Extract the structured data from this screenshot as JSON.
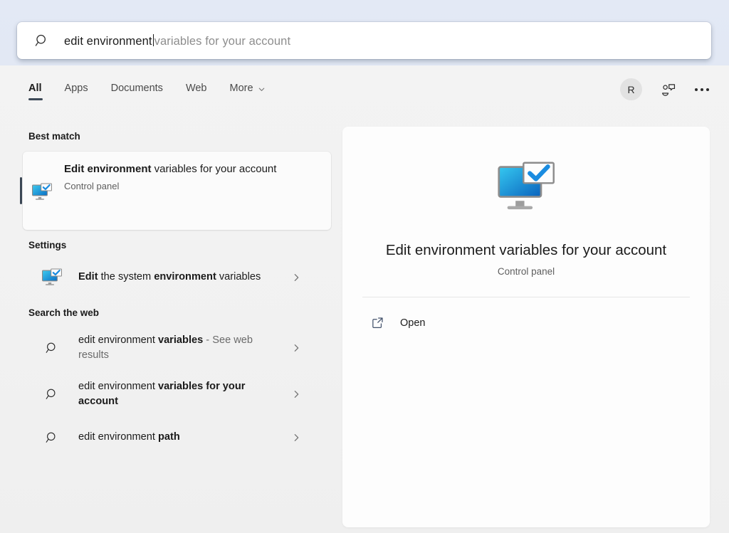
{
  "search": {
    "icon": "search-icon",
    "typed_text": "edit environment",
    "suggestion_text": "variables for your account",
    "full_value": "edit environment variables for your account"
  },
  "header": {
    "tabs": [
      {
        "label": "All",
        "active": true
      },
      {
        "label": "Apps",
        "active": false
      },
      {
        "label": "Documents",
        "active": false
      },
      {
        "label": "Web",
        "active": false
      },
      {
        "label": "More",
        "active": false,
        "icon": "chevron-down-icon"
      }
    ],
    "avatar_initial": "R",
    "feedback_icon": "feedback-person-icon",
    "overflow_icon": "more-dots-icon"
  },
  "results": {
    "best_match": {
      "heading": "Best match",
      "icon": "monitor-check-icon",
      "title_bold": "Edit environment",
      "title_rest": " variables for your account",
      "subtitle": "Control panel"
    },
    "settings": {
      "heading": "Settings",
      "icon": "monitor-check-icon",
      "parts": [
        {
          "text": "Edit",
          "bold": true
        },
        {
          "text": " the system ",
          "bold": false
        },
        {
          "text": "environment",
          "bold": true
        },
        {
          "text": " variables",
          "bold": false
        }
      ],
      "chevron": "chevron-right-icon"
    },
    "web": {
      "heading": "Search the web",
      "items": [
        {
          "icon": "search-icon",
          "parts": [
            {
              "text": "edit environment ",
              "bold": false
            },
            {
              "text": "variables",
              "bold": true
            },
            {
              "text": " - See web results",
              "bold": false,
              "muted": true
            }
          ],
          "chevron": "chevron-right-icon"
        },
        {
          "icon": "search-icon",
          "parts": [
            {
              "text": "edit environment ",
              "bold": false
            },
            {
              "text": "variables for your account",
              "bold": true
            }
          ],
          "chevron": "chevron-right-icon"
        },
        {
          "icon": "search-icon",
          "parts": [
            {
              "text": "edit environment ",
              "bold": false
            },
            {
              "text": "path",
              "bold": true
            }
          ],
          "chevron": "chevron-right-icon"
        }
      ]
    }
  },
  "preview": {
    "icon": "monitor-check-icon",
    "title": "Edit environment variables for your account",
    "subtitle": "Control panel",
    "action_label": "Open",
    "action_icon": "open-external-icon"
  },
  "colors": {
    "accent": "#3a4654",
    "icon_blue": "#0f8ddc",
    "icon_cyan": "#2ec3ea",
    "text_primary": "#1b1b1b",
    "text_secondary": "#5e5e5e",
    "panel_bg": "#f1f1f1",
    "card_bg": "#fbfbfb"
  }
}
